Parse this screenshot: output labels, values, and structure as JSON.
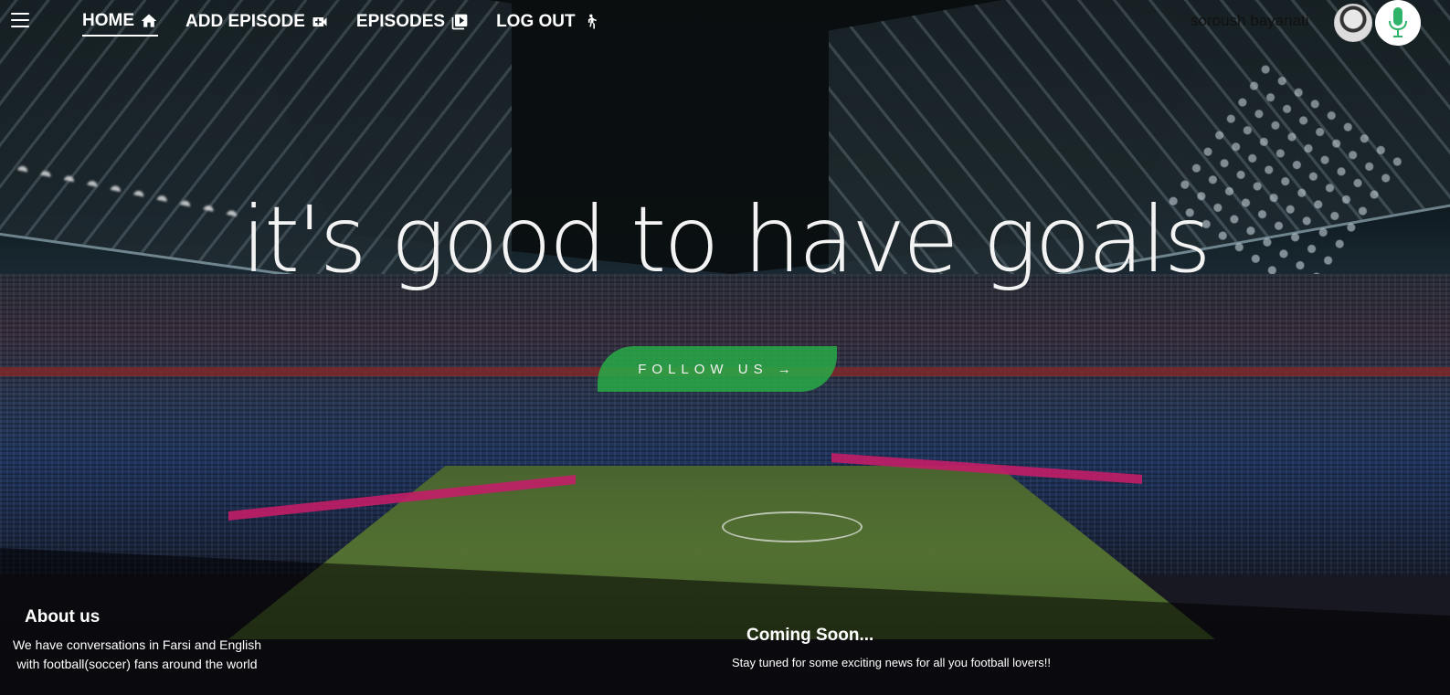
{
  "nav": {
    "items": [
      {
        "label": "HOME",
        "icon": "home-icon",
        "active": true
      },
      {
        "label": "ADD EPISODE",
        "icon": "video-add-icon",
        "active": false
      },
      {
        "label": "EPISODES",
        "icon": "playlist-play-icon",
        "active": false
      },
      {
        "label": "LOG OUT",
        "icon": "person-walking-icon",
        "active": false
      }
    ],
    "username": "soroush bayanati",
    "logo_icon": "microphone-icon",
    "menu_icon": "hamburger-menu-icon"
  },
  "hero": {
    "title": "it's good to have goals",
    "button_label": "FOLLOW US →"
  },
  "footer": {
    "about_title": "About us",
    "about_text": "We have conversations in Farsi and English with football(soccer) fans around the world",
    "soon_title": "Coming Soon...",
    "soon_text": "Stay tuned for some exciting news for all you football lovers!!"
  },
  "colors": {
    "accent_green": "#28aa46",
    "text": "#ffffff"
  }
}
